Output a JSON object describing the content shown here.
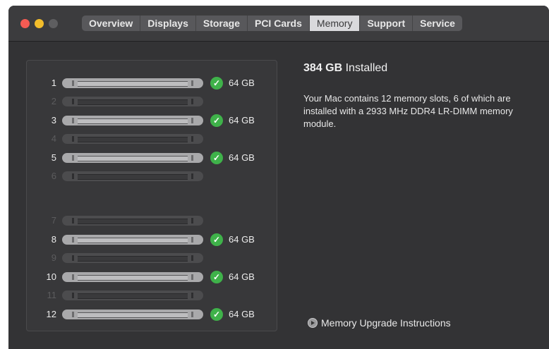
{
  "tabs": [
    "Overview",
    "Displays",
    "Storage",
    "PCI Cards",
    "Memory",
    "Support",
    "Service"
  ],
  "active_tab": "Memory",
  "slots": [
    {
      "number": "1",
      "installed": true,
      "size": "64 GB"
    },
    {
      "number": "2",
      "installed": false,
      "size": ""
    },
    {
      "number": "3",
      "installed": true,
      "size": "64 GB"
    },
    {
      "number": "4",
      "installed": false,
      "size": ""
    },
    {
      "number": "5",
      "installed": true,
      "size": "64 GB"
    },
    {
      "number": "6",
      "installed": false,
      "size": ""
    },
    {
      "number": "7",
      "installed": false,
      "size": ""
    },
    {
      "number": "8",
      "installed": true,
      "size": "64 GB"
    },
    {
      "number": "9",
      "installed": false,
      "size": ""
    },
    {
      "number": "10",
      "installed": true,
      "size": "64 GB"
    },
    {
      "number": "11",
      "installed": false,
      "size": ""
    },
    {
      "number": "12",
      "installed": true,
      "size": "64 GB"
    }
  ],
  "summary": {
    "amount": "384 GB",
    "suffix": "Installed",
    "description": "Your Mac contains 12 memory slots, 6 of which are installed with a 2933 MHz DDR4 LR-DIMM memory module."
  },
  "upgrade_link": "Memory Upgrade Instructions",
  "icons": {
    "slot_status": "checkmark-circle-icon",
    "upgrade_link": "play-circle-icon"
  },
  "colors": {
    "window_bg": "#333335",
    "check_green": "#3fb24a",
    "close": "#f45b53",
    "minimize": "#f2bd2b"
  }
}
